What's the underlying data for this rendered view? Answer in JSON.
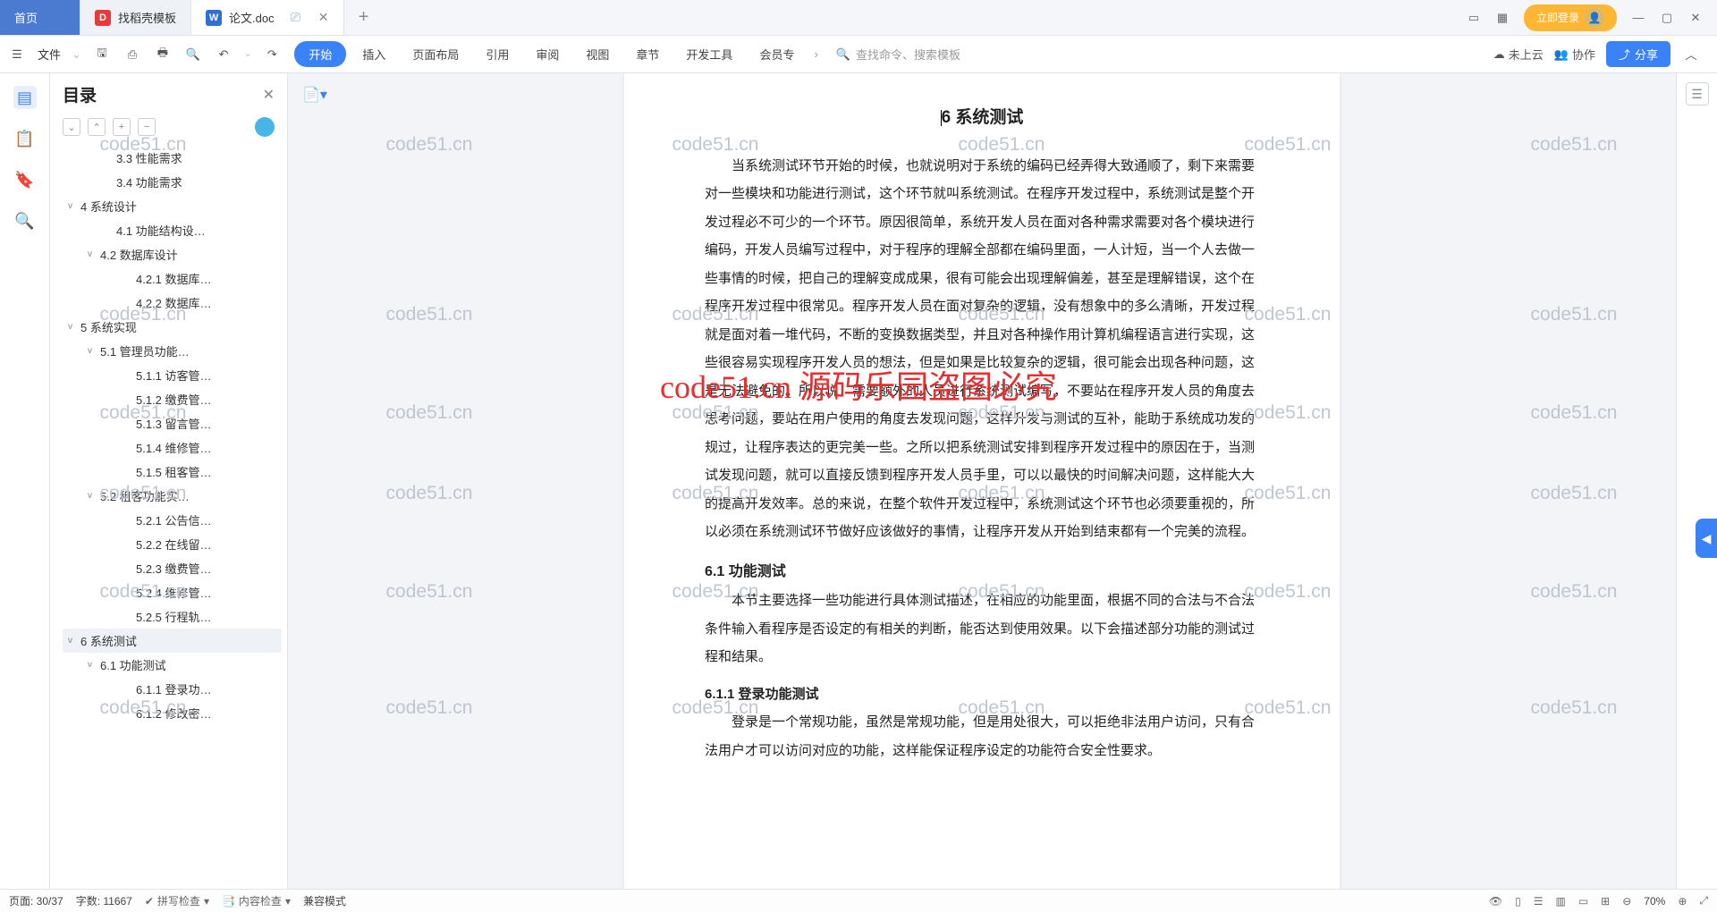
{
  "tabs": {
    "home": "首页",
    "templates": "找稻壳模板",
    "doc": "论文.doc"
  },
  "winctrl": {
    "login": "立即登录"
  },
  "toolbar": {
    "file": "文件",
    "menu": [
      "开始",
      "插入",
      "页面布局",
      "引用",
      "审阅",
      "视图",
      "章节",
      "开发工具",
      "会员专"
    ],
    "search": "查找命令、搜索模板",
    "notuploaded": "未上云",
    "collab": "协作",
    "share": "分享"
  },
  "sidebar": {
    "title": "目录",
    "items": [
      {
        "lv": 3,
        "chev": "",
        "label": "3.3 性能需求"
      },
      {
        "lv": 3,
        "chev": "",
        "label": "3.4 功能需求"
      },
      {
        "lv": 1,
        "chev": "v",
        "label": "4 系统设计"
      },
      {
        "lv": 3,
        "chev": "",
        "label": "4.1 功能结构设…"
      },
      {
        "lv": 2,
        "chev": "v",
        "label": "4.2 数据库设计"
      },
      {
        "lv": 4,
        "chev": "",
        "label": "4.2.1 数据库…"
      },
      {
        "lv": 4,
        "chev": "",
        "label": "4.2.2 数据库…"
      },
      {
        "lv": 1,
        "chev": "v",
        "label": "5 系统实现"
      },
      {
        "lv": 2,
        "chev": "v",
        "label": "5.1 管理员功能…"
      },
      {
        "lv": 4,
        "chev": "",
        "label": "5.1.1 访客管…"
      },
      {
        "lv": 4,
        "chev": "",
        "label": "5.1.2 缴费管…"
      },
      {
        "lv": 4,
        "chev": "",
        "label": "5.1.3 留言管…"
      },
      {
        "lv": 4,
        "chev": "",
        "label": "5.1.4 维修管…"
      },
      {
        "lv": 4,
        "chev": "",
        "label": "5.1.5 租客管…"
      },
      {
        "lv": 2,
        "chev": "v",
        "label": "5.2 租客功能实…"
      },
      {
        "lv": 4,
        "chev": "",
        "label": "5.2.1 公告信…"
      },
      {
        "lv": 4,
        "chev": "",
        "label": "5.2.2 在线留…"
      },
      {
        "lv": 4,
        "chev": "",
        "label": "5.2.3 缴费管…"
      },
      {
        "lv": 4,
        "chev": "",
        "label": "5.2.4 维修管…"
      },
      {
        "lv": 4,
        "chev": "",
        "label": "5.2.5 行程轨…"
      },
      {
        "lv": 1,
        "chev": "v",
        "label": "6 系统测试",
        "sel": true
      },
      {
        "lv": 2,
        "chev": "v",
        "label": "6.1 功能测试"
      },
      {
        "lv": 4,
        "chev": "",
        "label": "6.1.1 登录功…"
      },
      {
        "lv": 4,
        "chev": "",
        "label": "6.1.2 修改密…"
      }
    ]
  },
  "document": {
    "h2": "6 系统测试",
    "p1": "当系统测试环节开始的时候，也就说明对于系统的编码已经弄得大致通顺了，剩下来需要对一些模块和功能进行测试，这个环节就叫系统测试。在程序开发过程中，系统测试是整个开发过程必不可少的一个环节。原因很简单，系统开发人员在面对各种需求需要对各个模块进行编码，开发人员编写过程中，对于程序的理解全部都在编码里面，一人计短，当一个人去做一些事情的时候，把自己的理解变成成果，很有可能会出现理解偏差，甚至是理解错误，这个在程序开发过程中很常见。程序开发人员在面对复杂的逻辑，没有想象中的多么清晰，开发过程就是面对着一堆代码，不断的变换数据类型，并且对各种操作用计算机编程语言进行实现，这些很容易实现程序开发人员的想法，但是如果是比较复杂的逻辑，很可能会出现各种问题，这是无法避免的。所以说，需要额外的人员进行系统测试编写，不要站在程序开发人员的角度去思考问题，要站在用户使用的角度去发现问题，这样升发与测试的互补，能助于系统成功发的规过，让程序表达的更完美一些。之所以把系统测试安排到程序开发过程中的原因在于，当测试发现问题，就可以直接反馈到程序开发人员手里，可以以最快的时间解决问题，这样能大大的提高开发效率。总的来说，在整个软件开发过程中，系统测试这个环节也必须要重视的，所以必须在系统测试环节做好应该做好的事情，让程序开发从开始到结束都有一个完美的流程。",
    "h3": "6.1 功能测试",
    "p2": "本节主要选择一些功能进行具体测试描述，在相应的功能里面，根据不同的合法与不合法条件输入看程序是否设定的有相关的判断，能否达到使用效果。以下会描述部分功能的测试过程和结果。",
    "h4": "6.1.1 登录功能测试",
    "p3": "登录是一个常规功能，虽然是常规功能，但是用处很大，可以拒绝非法用户访问，只有合法用户才可以访问对应的功能，这样能保证程序设定的功能符合安全性要求。"
  },
  "watermark": "code51.cn",
  "overlay": "code51.cn 源码乐园盗图必究",
  "status": {
    "page": "页面: 30/37",
    "words": "字数: 11667",
    "spell": "拼写检查",
    "content": "内容检查",
    "compat": "兼容模式",
    "zoom": "70%"
  }
}
